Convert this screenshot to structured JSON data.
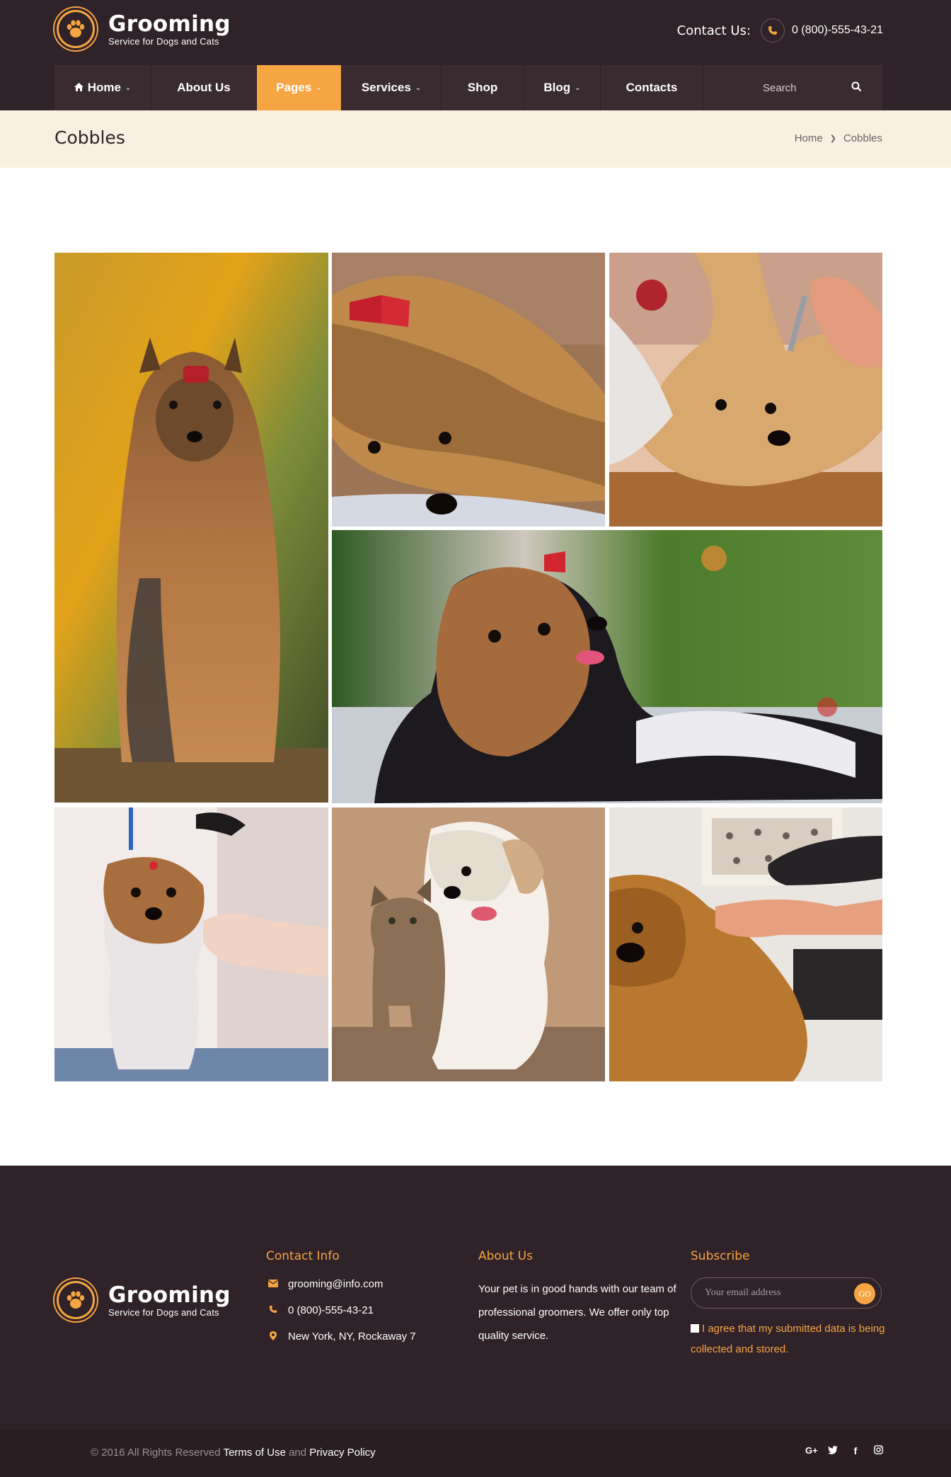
{
  "header": {
    "logo_title": "Grooming",
    "logo_subtitle": "Service for Dogs and Cats",
    "contact_label": "Contact Us:",
    "phone": "0 (800)-555-43-21"
  },
  "nav": {
    "items": [
      {
        "label": "Home",
        "has_dropdown": true
      },
      {
        "label": "About Us",
        "has_dropdown": false
      },
      {
        "label": "Pages",
        "has_dropdown": true,
        "active": true
      },
      {
        "label": "Services",
        "has_dropdown": true
      },
      {
        "label": "Shop",
        "has_dropdown": false
      },
      {
        "label": "Blog",
        "has_dropdown": true
      },
      {
        "label": "Contacts",
        "has_dropdown": false
      }
    ],
    "search_placeholder": "Search"
  },
  "page": {
    "title": "Cobbles",
    "breadcrumb": [
      "Home",
      "Cobbles"
    ]
  },
  "gallery": {
    "images": [
      {
        "subject": "yorkshire-terrier-long-hair-bow"
      },
      {
        "subject": "yorkshire-terrier-lying-bow"
      },
      {
        "subject": "yorkshire-terrier-being-combed"
      },
      {
        "subject": "yorkshire-terrier-lying-garden"
      },
      {
        "subject": "yorkshire-terrier-grooming-table"
      },
      {
        "subject": "puppy-and-kitten"
      },
      {
        "subject": "chow-chow-blow-dry"
      }
    ]
  },
  "footer": {
    "logo_title": "Grooming",
    "logo_subtitle": "Service for Dogs and Cats",
    "contact_heading": "Contact Info",
    "email": "grooming@info.com",
    "phone": "0 (800)-555-43-21",
    "address": "New York, NY, Rockaway 7",
    "about_heading": "About Us",
    "about_text": "Your pet is in good hands with our team of professional groomers. We offer only top quality service.",
    "subscribe_heading": "Subscribe",
    "email_placeholder": "Your email address",
    "go_label": "GO",
    "agree_text": "I agree that my submitted data is being collected and stored."
  },
  "bottom": {
    "copyright": "© 2016 All Rights Reserved",
    "terms": "Terms of Use",
    "and": "and",
    "privacy": "Privacy Policy",
    "social_icons": [
      "google-plus-icon",
      "twitter-icon",
      "facebook-icon",
      "instagram-icon"
    ]
  },
  "colors": {
    "dark": "#2f2228",
    "accent": "#f5a542",
    "title_bar": "#f8f1e1"
  }
}
